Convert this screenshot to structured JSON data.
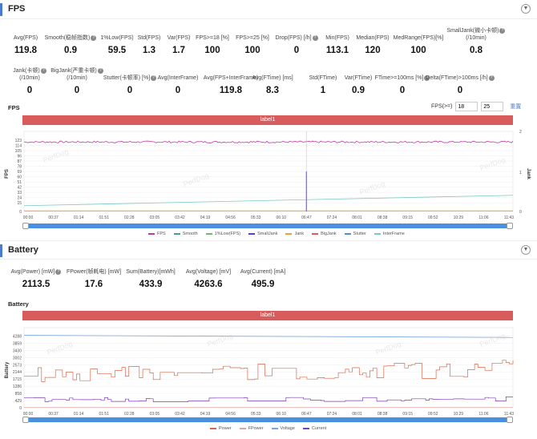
{
  "fps_section": {
    "title": "FPS",
    "metrics_row1": [
      {
        "label": "Avg(FPS)",
        "value": "119.8",
        "help": false
      },
      {
        "label": "Smooth(稳帧指数)",
        "value": "0.9",
        "help": true
      },
      {
        "label": "1%Low(FPS)",
        "value": "59.5",
        "help": false
      },
      {
        "label": "Std(FPS)",
        "value": "1.3",
        "help": false
      },
      {
        "label": "Var(FPS)",
        "value": "1.7",
        "help": false
      },
      {
        "label": "FPS>=18 [%]",
        "value": "100",
        "help": false
      },
      {
        "label": "FPS>=25 [%]",
        "value": "100",
        "help": false
      },
      {
        "label": "Drop(FPS) [/h]",
        "value": "0",
        "help": true
      },
      {
        "label": "Min(FPS)",
        "value": "113.1",
        "help": false
      },
      {
        "label": "Median(FPS)",
        "value": "120",
        "help": false
      },
      {
        "label": "MedRange(FPS)[%]",
        "value": "100",
        "help": false
      },
      {
        "label": "SmallJank(微小卡顿)",
        "label2": "(/10min)",
        "value": "0.8",
        "help": true
      }
    ],
    "metrics_row2": [
      {
        "label": "Jank(卡顿)",
        "label2": "(/10min)",
        "value": "0",
        "help": true
      },
      {
        "label": "BigJank(严重卡顿)",
        "label2": "(/10min)",
        "value": "0",
        "help": true
      },
      {
        "label": "Stutter(卡顿率) [%]",
        "value": "0",
        "help": true
      },
      {
        "label": "Avg(InterFrame)",
        "value": "0",
        "help": false
      },
      {
        "label": "Avg(FPS+InterFrame)",
        "value": "119.8",
        "help": false
      },
      {
        "label": "Avg(FTime) [ms]",
        "value": "8.3",
        "help": false
      },
      {
        "label": "Std(FTime)",
        "value": "1",
        "help": false
      },
      {
        "label": "Var(FTime)",
        "value": "0.9",
        "help": false
      },
      {
        "label": "FTime>=100ms [%]",
        "value": "0",
        "help": true
      },
      {
        "label": "Delta(FTime)>100ms [/h]",
        "value": "0",
        "help": true
      }
    ],
    "chart_title": "FPS",
    "fps_threshold_label": "FPS(>=)",
    "fps_threshold_1": "18",
    "fps_threshold_2": "25",
    "reset_label": "重置",
    "label_bar": "label1"
  },
  "battery_section": {
    "title": "Battery",
    "metrics": [
      {
        "label": "Avg(Power) [mW]",
        "value": "2113.5",
        "help": true
      },
      {
        "label": "FPower(帧耗电) [mW]",
        "value": "17.6",
        "help": false
      },
      {
        "label": "Sum(Battery)[mWh]",
        "value": "433.9",
        "help": false
      },
      {
        "label": "Avg(Voltage) [mV]",
        "value": "4263.6",
        "help": false
      },
      {
        "label": "Avg(Current) [mA]",
        "value": "495.9",
        "help": false
      }
    ],
    "chart_title": "Battery",
    "label_bar": "label1"
  },
  "watermark": "PerfDog",
  "chart_data": [
    {
      "type": "line",
      "title": "FPS",
      "ylabel": "FPS",
      "y2label": "Jank",
      "ylim": [
        0,
        130
      ],
      "y_ticks": [
        "123",
        "114",
        "105",
        "96",
        "87",
        "78",
        "69",
        "60",
        "51",
        "42",
        "33",
        "24",
        "15",
        "6"
      ],
      "y_ticks_raw": [
        "123",
        "114",
        "105",
        "96",
        "87",
        "78",
        "69",
        "60",
        "51",
        "42",
        "33",
        "24",
        "15",
        "0"
      ],
      "y2_ticks": [
        "2",
        "1",
        "0"
      ],
      "x_ticks": [
        "00:00",
        "00:37",
        "01:14",
        "01:51",
        "02:28",
        "03:05",
        "03:42",
        "04:19",
        "04:56",
        "05:33",
        "06:10",
        "06:47",
        "07:24",
        "08:01",
        "08:38",
        "09:15",
        "09:52",
        "10:29",
        "11:06",
        "11:43"
      ],
      "series": [
        {
          "name": "FPS",
          "color": "#c0399f",
          "approx_value": 120
        },
        {
          "name": "Smooth",
          "color": "#3ba69a"
        },
        {
          "name": "1%Low(FPS)",
          "color": "#6fb86f"
        },
        {
          "name": "SmallJank",
          "color": "#5b3bd1",
          "spike_at": "06:47"
        },
        {
          "name": "Jank",
          "color": "#e6a23c"
        },
        {
          "name": "BigJank",
          "color": "#e05b5b"
        },
        {
          "name": "Stutter",
          "color": "#4a90e2"
        },
        {
          "name": "InterFrame",
          "color": "#7ec8c0"
        }
      ]
    },
    {
      "type": "line",
      "title": "Battery",
      "ylabel": "Battery",
      "y_ticks": [
        "4288",
        "3859",
        "3430",
        "3002",
        "2573",
        "2144",
        "1715",
        "1286",
        "858",
        "429",
        "0"
      ],
      "ylim": [
        0,
        4500
      ],
      "x_ticks": [
        "00:00",
        "00:37",
        "01:14",
        "01:51",
        "02:28",
        "03:05",
        "03:42",
        "04:19",
        "04:56",
        "05:33",
        "06:10",
        "06:47",
        "07:24",
        "08:01",
        "08:38",
        "09:15",
        "09:52",
        "10:29",
        "11:06",
        "11:43"
      ],
      "series": [
        {
          "name": "Power",
          "color": "#d9684a",
          "approx_range": [
            1500,
            2900
          ]
        },
        {
          "name": "FPower",
          "color": "#e8a0a0",
          "approx_value": 20
        },
        {
          "name": "Voltage",
          "color": "#7aa6d8",
          "approx_range": [
            4200,
            4330
          ]
        },
        {
          "name": "Current",
          "color": "#7b3fbf",
          "approx_range": [
            330,
            700
          ]
        }
      ]
    }
  ]
}
